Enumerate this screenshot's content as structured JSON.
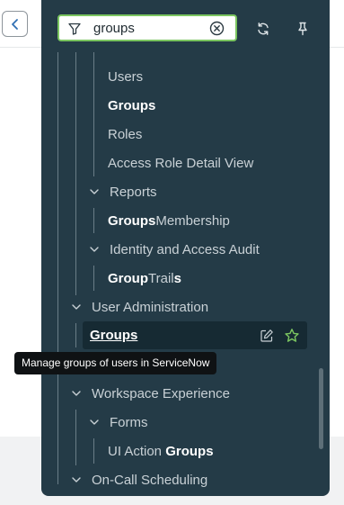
{
  "filter": {
    "value": "groups",
    "placeholder": ""
  },
  "header_icons": [
    "refresh-icon",
    "pin-icon"
  ],
  "tree": {
    "partial_top_label": "",
    "items": [
      {
        "text": "Users"
      },
      {
        "match": "Groups"
      },
      {
        "text": "Roles"
      },
      {
        "text": "Access Role Detail View"
      },
      {
        "text": "Reports"
      },
      {
        "match": "Groups",
        "text": " Membership"
      },
      {
        "text": "Identity and Access Audit"
      },
      {
        "match": "Group",
        "text": " Trail",
        "match2": "s"
      },
      {
        "text": "User Administration"
      },
      {
        "match": "Groups"
      },
      {
        "text": "Workspace Experience"
      },
      {
        "text": "Forms"
      },
      {
        "text": "UI Action ",
        "match": "Groups"
      },
      {
        "text": "On-Call Scheduling"
      }
    ]
  },
  "tooltip": "Manage groups of users in ServiceNow",
  "colors": {
    "panel": "#243b47",
    "selected_row": "#162a33",
    "filter_border": "#7bc560",
    "star": "#7bc560",
    "tooltip_bg": "#0f1214"
  }
}
